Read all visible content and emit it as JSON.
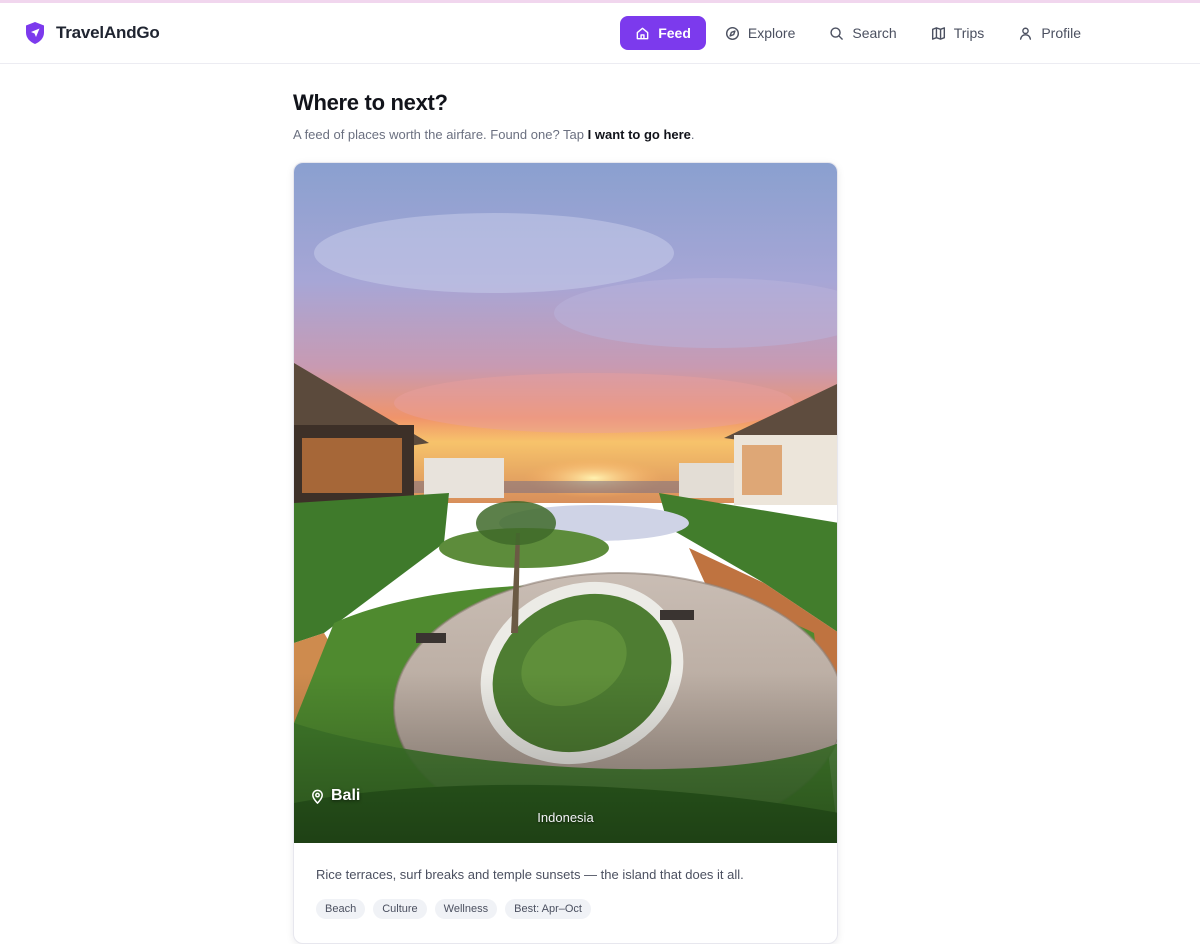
{
  "app": {
    "brand": "TravelAndGo",
    "accent_color": "#7c3aed"
  },
  "nav": {
    "items": [
      {
        "label": "Feed",
        "icon": "home-icon",
        "active": true
      },
      {
        "label": "Explore",
        "icon": "compass-icon",
        "active": false
      },
      {
        "label": "Search",
        "icon": "search-icon",
        "active": false
      },
      {
        "label": "Trips",
        "icon": "map-icon",
        "active": false
      },
      {
        "label": "Profile",
        "icon": "user-icon",
        "active": false
      }
    ]
  },
  "page": {
    "title": "Where to next?",
    "subtitle_prefix": "A feed of places worth the airfare. Found one? Tap ",
    "subtitle_action": "I want to go here",
    "subtitle_suffix": "."
  },
  "card": {
    "place": "Bali",
    "country": "Indonesia",
    "pin_icon": "map-pin-icon",
    "description": "Rice terraces, surf breaks and temple sunsets — the island that does it all.",
    "tags": [
      "Beach",
      "Culture",
      "Wellness",
      "Best: Apr–Oct"
    ]
  }
}
